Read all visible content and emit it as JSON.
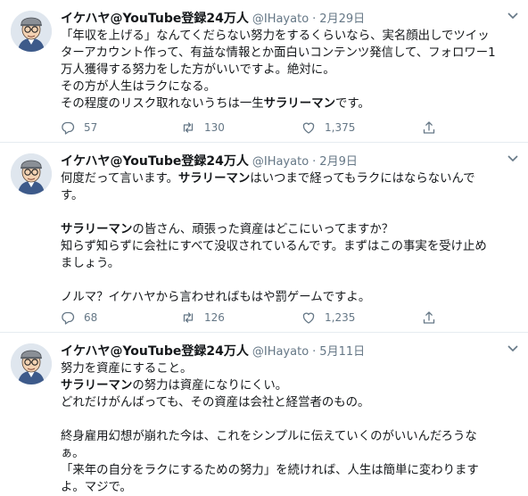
{
  "tweets": [
    {
      "author": "イケハヤ@YouTube登録24万人",
      "handle": "@IHayato",
      "separator": "·",
      "date": "2月29日",
      "lines": [
        [
          {
            "t": "「年収を上げる」なんてくだらない努力をするくらいなら、実名顔出しでツイッ"
          }
        ],
        [
          {
            "t": "ターアカウント作って、有益な情報とか面白いコンテンツ発信して、フォロワー1"
          }
        ],
        [
          {
            "t": "万人獲得する努力をした方がいいですよ。絶対に。"
          }
        ],
        [
          {
            "t": "その方が人生はラクになる。"
          }
        ],
        [
          {
            "t": "その程度のリスク取れないうちは一生"
          },
          {
            "t": "サラリーマン",
            "b": true
          },
          {
            "t": "です。"
          }
        ]
      ],
      "reply_count": "57",
      "retweet_count": "130",
      "like_count": "1,375"
    },
    {
      "author": "イケハヤ@YouTube登録24万人",
      "handle": "@IHayato",
      "separator": "·",
      "date": "2月9日",
      "lines": [
        [
          {
            "t": "何度だって言います。"
          },
          {
            "t": "サラリーマン",
            "b": true
          },
          {
            "t": "はいつまで経ってもラクにはならないんで"
          }
        ],
        [
          {
            "t": "す。"
          }
        ],
        [],
        [
          {
            "t": "サラリーマン",
            "b": true
          },
          {
            "t": "の皆さん、頑張った資産はどこにいってますか？"
          }
        ],
        [
          {
            "t": "知らず知らずに会社にすべて没収されているんです。まずはこの事実を受け止め"
          }
        ],
        [
          {
            "t": "ましょう。"
          }
        ],
        [],
        [
          {
            "t": "ノルマ？イケハヤから言わせればもはや罰ゲームですよ。"
          }
        ]
      ],
      "reply_count": "68",
      "retweet_count": "126",
      "like_count": "1,235"
    },
    {
      "author": "イケハヤ@YouTube登録24万人",
      "handle": "@IHayato",
      "separator": "·",
      "date": "5月11日",
      "lines": [
        [
          {
            "t": "努力を資産にすること。"
          }
        ],
        [
          {
            "t": "サラリーマン",
            "b": true
          },
          {
            "t": "の努力は資産になりにくい。"
          }
        ],
        [
          {
            "t": "どれだけがんばっても、その資産は会社と経営者のもの。"
          }
        ],
        [],
        [
          {
            "t": "終身雇用幻想が崩れた今は、これをシンプルに伝えていくのがいいんだろうな"
          }
        ],
        [
          {
            "t": "ぁ。"
          }
        ],
        [
          {
            "t": "「来年の自分をラクにするための努力」を続ければ、人生は簡単に変わります"
          }
        ],
        [
          {
            "t": "よ。マジで。"
          }
        ]
      ]
    }
  ]
}
